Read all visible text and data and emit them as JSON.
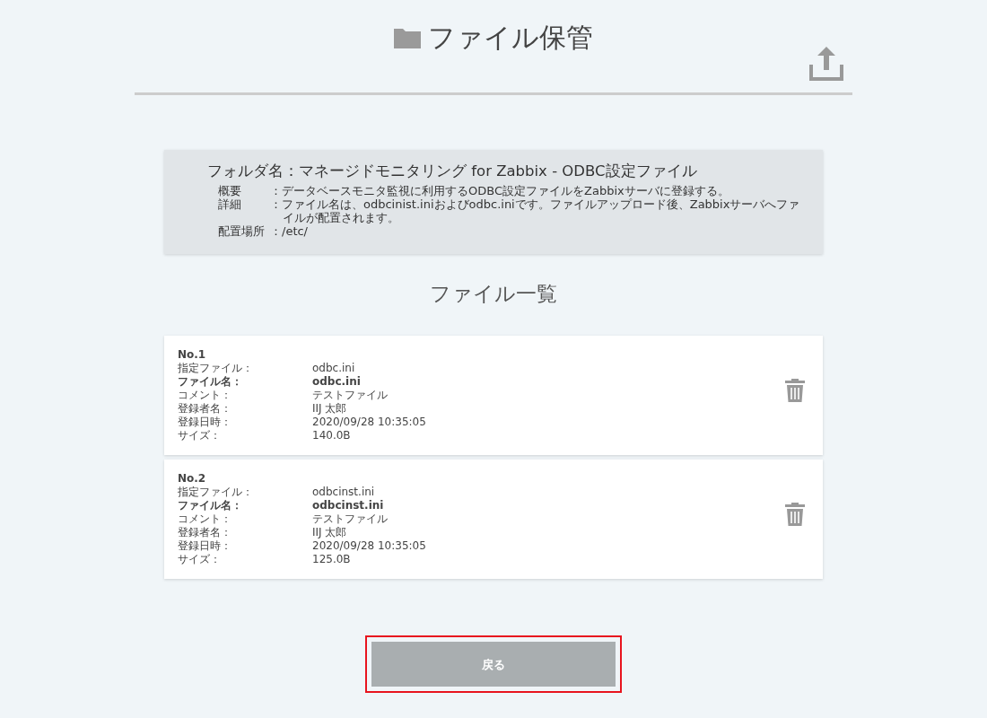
{
  "header": {
    "title": "ファイル保管"
  },
  "folder_info": {
    "folder_label": "フォルダ名：マネージドモニタリング for Zabbix - ODBC設定ファイル",
    "rows": [
      {
        "label": "概要",
        "value": "：データベースモニタ監視に利用するODBC設定ファイルをZabbixサーバに登録する。"
      },
      {
        "label": "詳細",
        "value": "：ファイル名は、odbcinist.iniおよびodbc.iniです。ファイルアップロード後、Zabbixサーバへファイルが配置されます。"
      },
      {
        "label": "配置場所",
        "value": "：/etc/"
      }
    ]
  },
  "list_title": "ファイル一覧",
  "files": [
    {
      "number": "No.1",
      "fields": [
        {
          "label": "指定ファイル：",
          "value": "odbc.ini",
          "bold": false
        },
        {
          "label": "ファイル名：",
          "value": "odbc.ini",
          "bold": true
        },
        {
          "label": "コメント：",
          "value": "テストファイル",
          "bold": false
        },
        {
          "label": "登録者名：",
          "value": "IIJ 太郎",
          "bold": false
        },
        {
          "label": "登録日時：",
          "value": "2020/09/28 10:35:05",
          "bold": false
        },
        {
          "label": "サイズ：",
          "value": "140.0B",
          "bold": false
        }
      ]
    },
    {
      "number": "No.2",
      "fields": [
        {
          "label": "指定ファイル：",
          "value": "odbcinst.ini",
          "bold": false
        },
        {
          "label": "ファイル名：",
          "value": "odbcinst.ini",
          "bold": true
        },
        {
          "label": "コメント：",
          "value": "テストファイル",
          "bold": false
        },
        {
          "label": "登録者名：",
          "value": "IIJ 太郎",
          "bold": false
        },
        {
          "label": "登録日時：",
          "value": "2020/09/28 10:35:05",
          "bold": false
        },
        {
          "label": "サイズ：",
          "value": "125.0B",
          "bold": false
        }
      ]
    }
  ],
  "back_button": {
    "label": "戻る",
    "highlighted": true
  }
}
